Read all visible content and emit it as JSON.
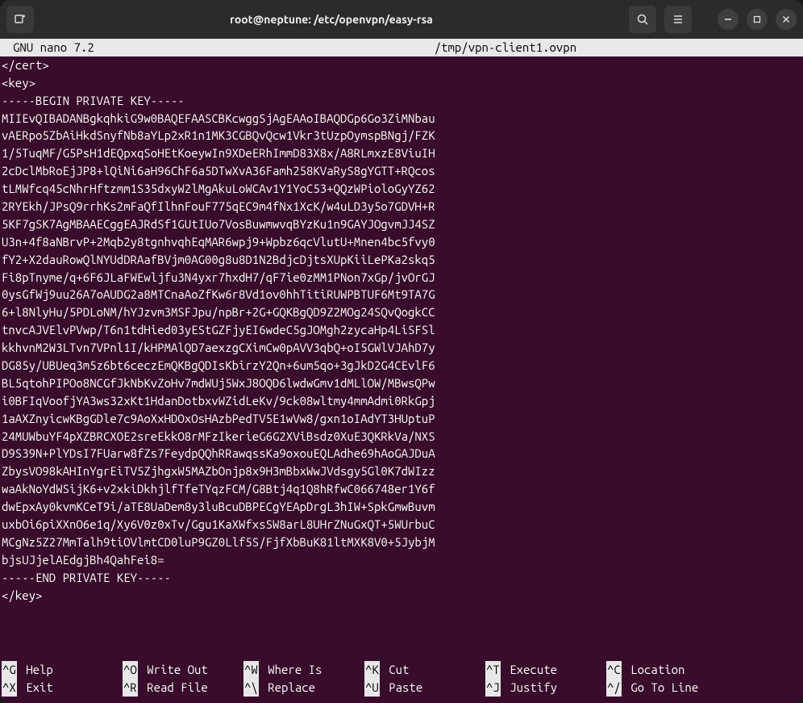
{
  "titlebar": {
    "title": "root@neptune: /etc/openvpn/easy-rsa"
  },
  "nano": {
    "app_title": "GNU nano 7.2",
    "file_path": "/tmp/vpn-client1.ovpn",
    "body_lines": [
      "</cert>",
      "<key>",
      "-----BEGIN PRIVATE KEY-----",
      "MIIEvQIBADANBgkqhkiG9w0BAQEFAASCBKcwggSjAgEAAoIBAQDGp6Go3ZiMNbau",
      "vAERpo5ZbAiHkdSnyfNb8aYLp2xR1n1MK3CGBQvQcw1Vkr3tUzpOymspBNgj/FZK",
      "1/5TuqMF/G5PsH1dEQpxqSoHEtKoeywIn9XDeERhImmD83X8x/A8RLmxzE8ViuIH",
      "2cDclMbRoEjJP8+lQiNi6aH96ChF6a5DTwXvA36Famh258KVaRyS8gYGTT+RQcos",
      "tLMWfcq45cNhrHftzmm1S35dxyW2lMgAkuLoWCAv1Y1YoC53+QQzWPioloGyYZ62",
      "2RYEkh/JPsQ9rrhKs2mFaQfIlhnFouF775qEC9m4fNx1XcK/w4uLD3y5o7GDVH+R",
      "5KF7gSK7AgMBAAECggEAJRdSf1GUtIUo7VosBuwmwvqBYzKu1n9GAYJOgvmJJ4SZ",
      "U3n+4f8aNBrvP+2Mqb2y8tgnhvqhEqMAR6wpj9+Wpbz6qcVlutU+Mnen4bc5fvy0",
      "fY2+X2dauRowQlNYUdDRAafBVjm0AG00g8u8D1N2BdjcDjtsXUpKiiLePKa2skq5",
      "Fi8pTnyme/q+6F6JLaFWEwljfu3N4yxr7hxdH7/qF7ie0zMM1PNon7xGp/jvOrGJ",
      "0ysGfWj9uu26A7oAUDG2a8MTCnaAoZfKw6r8Vd1ov0hhTitiRUWPBTUF6Mt9TA7G",
      "6+l8NlyHu/5PDLoNM/hYJzvm3MSFJpu/npBr+2G+GQKBgQD9Z2MOg24SQvQogkCC",
      "tnvcAJVElvPVwp/T6n1tdHied03yEStGZFjyEI6wdeC5gJOMgh2zycaHp4LiSFSl",
      "kkhvnM2W3LTvn7VPnl1I/kHPMAlQD7aexzgCXimCw0pAVV3qbQ+oI5GWlVJAhD7y",
      "DG85y/UBUeq3m5z6bt6ceczEmQKBgQDIsKbirzY2Qn+6um5qo+3gJkD2G4CEvlF6",
      "BL5qtohPIPOo8NCGfJkNbKvZoHv7mdWUj5WxJ8OQD6lwdwGmv1dMLlOW/MBwsQPw",
      "i0BFIqVoofjYA3ws32xKt1HdanDotbxvWZidLeKv/9ck08wltmy4mmAdmi0RkGpj",
      "1aAXZnyicwKBgGDle7c9AoXxHDOxOsHAzbPedTV5E1wVw8/gxn1oIAdYT3HUptuP",
      "24MUWbuYF4pXZBRCXOE2sreEkkO8rMFzIkerieG6G2XViBsdz0XuE3QKRkVa/NXS",
      "D9S39N+PlYDsI7FUarw8fZs7FeydpQQhRRawqssKa9oxouEQLAdhe69hAoGAJDuA",
      "ZbysVO98kAHInYgrEiTV5ZjhgxW5MAZbOnjp8x9H3mBbxWwJVdsgy5Gl0K7dWIzz",
      "waAkNoYdWSijK6+v2xkiDkhjlfTfeTYqzFCM/G8Btj4q1Q8hRfwC066748er1Y6f",
      "dwEpxAy0kvmKCeT9i/aTE8UaDem8y3luBcuDBPECgYEApDrgL3hIW+SpkGmwBuvm",
      "uxbOi6piXXnO6e1q/Xy6V0z0xTv/Ggu1KaXWfxsSW8arL8UHrZNuGxQT+5WUrbuC",
      "MCgNz5Z27MmTalh9tiOVlmtCD0luP9GZ0Llf5S/FjfXbBuK81ltMXK8V0+5JybjM",
      "bjsUJjelAEdgjBh4QahFei8=",
      "-----END PRIVATE KEY-----",
      "</key>"
    ],
    "shortcuts_row1": [
      {
        "key": "^G",
        "label": "Help"
      },
      {
        "key": "^O",
        "label": "Write Out"
      },
      {
        "key": "^W",
        "label": "Where Is"
      },
      {
        "key": "^K",
        "label": "Cut"
      },
      {
        "key": "^T",
        "label": "Execute"
      },
      {
        "key": "^C",
        "label": "Location"
      }
    ],
    "shortcuts_row2": [
      {
        "key": "^X",
        "label": "Exit"
      },
      {
        "key": "^R",
        "label": "Read File"
      },
      {
        "key": "^\\",
        "label": "Replace"
      },
      {
        "key": "^U",
        "label": "Paste"
      },
      {
        "key": "^J",
        "label": "Justify"
      },
      {
        "key": "^/",
        "label": "Go To Line"
      }
    ]
  }
}
